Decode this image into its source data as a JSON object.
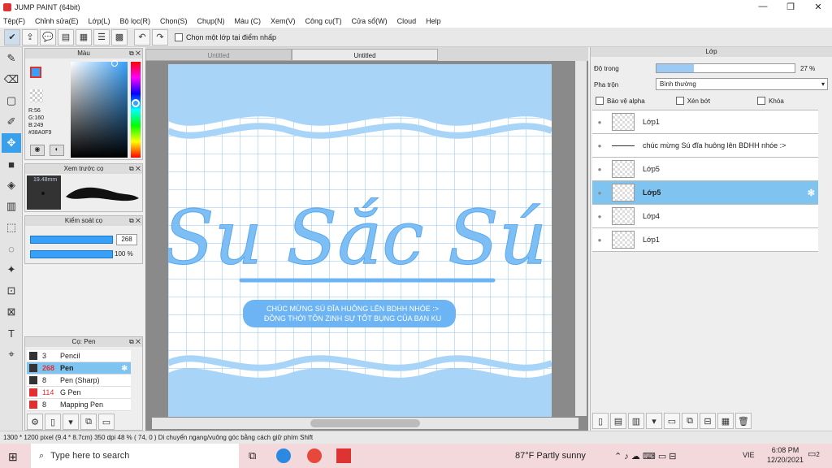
{
  "window": {
    "title": "JUMP PAINT (64bit)"
  },
  "menu": [
    "Tệp(F)",
    "Chỉnh sửa(E)",
    "Lớp(L)",
    "Bộ lọc(R)",
    "Chọn(S)",
    "Chụp(N)",
    "Màu (C)",
    "Xem(V)",
    "Công cụ(T)",
    "Cửa sổ(W)",
    "Cloud",
    "Help"
  ],
  "toolbar": {
    "select_layer_label": "Chọn một lớp tại điểm nhấp"
  },
  "color_panel": {
    "title": "Màu",
    "r": "R:56",
    "g": "G:160",
    "b": "B:249",
    "hex": "#38A0F9",
    "accent": "#38A0F9"
  },
  "brush_preview": {
    "title": "Xem trước cọ",
    "size": "19.48mm"
  },
  "brush_control": {
    "title": "Kiểm soát cọ",
    "size_value": "268",
    "opacity_value": "100 %"
  },
  "brush_list": {
    "title": "Cọ: Pen",
    "items": [
      {
        "num": "3",
        "name": "Pencil",
        "color": "#333333"
      },
      {
        "num": "268",
        "name": "Pen",
        "color": "#333333",
        "selected": true
      },
      {
        "num": "8",
        "name": "Pen (Sharp)",
        "color": "#333333"
      },
      {
        "num": "114",
        "name": "G Pen",
        "color": "#e03030"
      },
      {
        "num": "8",
        "name": "Mapping Pen",
        "color": "#e03030"
      }
    ]
  },
  "tabs": [
    "Untitled",
    "Untitled"
  ],
  "artwork": {
    "title_text": "Su Sắc Sú",
    "banner_line1": "CHÚC MỪNG SÚ ĐĨA HUÔNG LÊN BDHH NHÓE :>",
    "banner_line2": "ĐỒNG THỜI TÔN ZINH SỰ TỐT BỤNG CỦA BẠN KU",
    "bg_color": "#a8d4f7",
    "text_color": "#7dbff5"
  },
  "layer_panel": {
    "title": "Lớp",
    "opacity_label": "Độ trong",
    "opacity_value": "27 %",
    "opacity_fraction": 0.27,
    "blend_label": "Pha trộn",
    "blend_value": "Bình thường",
    "alpha_lock": "Bảo vệ alpha",
    "clip": "Xén bớt",
    "lock": "Khóa",
    "layers": [
      {
        "name": "Lớp1",
        "selected": false
      },
      {
        "name": "chúc mừng Sú đĩa huông lên BDHH nhóe :>",
        "selected": false
      },
      {
        "name": "Lớp5",
        "selected": false
      },
      {
        "name": "Lớp5",
        "selected": true
      },
      {
        "name": "Lớp4",
        "selected": false
      },
      {
        "name": "Lớp1",
        "selected": false
      }
    ]
  },
  "status": {
    "text": "1300 * 1200 pixel   (9.4 * 8.7cm)   350 dpi   48 %   ( 74, 0 )   Di chuyển ngang/vuông góc bằng cách giữ phím Shift"
  },
  "taskbar": {
    "search_placeholder": "Type here to search",
    "weather": "87°F  Partly sunny",
    "lang": "VIE",
    "time": "6:08 PM",
    "date": "12/20/2021",
    "notif": "2"
  }
}
